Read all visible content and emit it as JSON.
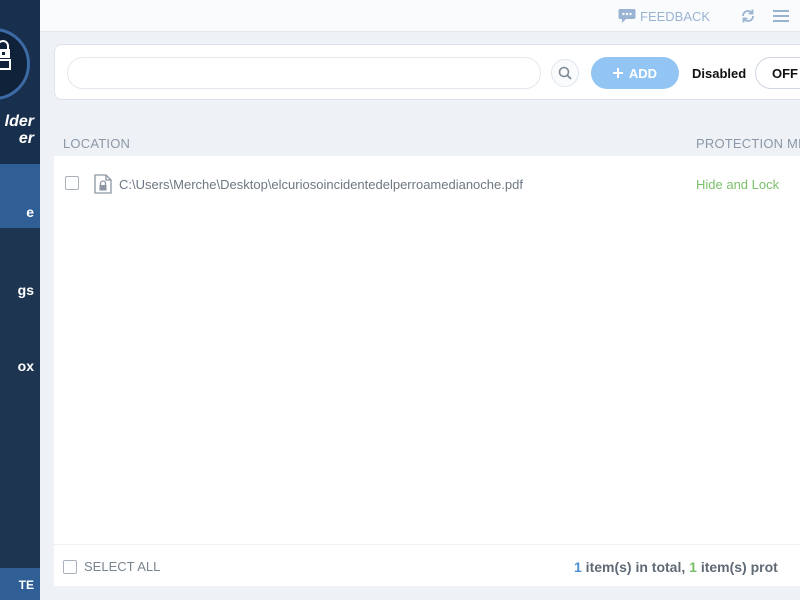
{
  "sidebar": {
    "brand_line1": "lder",
    "brand_line2": "er",
    "items": [
      {
        "label": "e",
        "active": true
      },
      {
        "label": "gs",
        "active": false
      },
      {
        "label": "ox",
        "active": false
      }
    ],
    "bottom_label": "TE"
  },
  "topbar": {
    "feedback_label": "FEEDBACK",
    "feedback_icon": "chat-bubble-icon",
    "refresh_icon": "refresh-icon",
    "menu_icon": "hamburger-menu-icon"
  },
  "toolbar": {
    "search_value": "",
    "search_placeholder": "",
    "add_label": "ADD",
    "status_label": "Disabled",
    "toggle_label": "OFF"
  },
  "table": {
    "columns": [
      "LOCATION",
      "PROTECTION MET"
    ],
    "rows": [
      {
        "path": "C:\\Users\\Merche\\Desktop\\elcuriosoincidentedelperroamedianoche.pdf",
        "method": "Hide and Lock"
      }
    ],
    "select_all_label": "SELECT ALL",
    "summary": {
      "total_count": "1",
      "total_text": " item(s) in total, ",
      "protected_count": "1",
      "protected_text": " item(s) prot"
    }
  },
  "colors": {
    "sidebar_bg": "#1e3551",
    "sidebar_active": "#2f5f95",
    "accent_blue": "#93c5f4",
    "method_green": "#7ac06b",
    "count_blue": "#4f8fd6"
  }
}
